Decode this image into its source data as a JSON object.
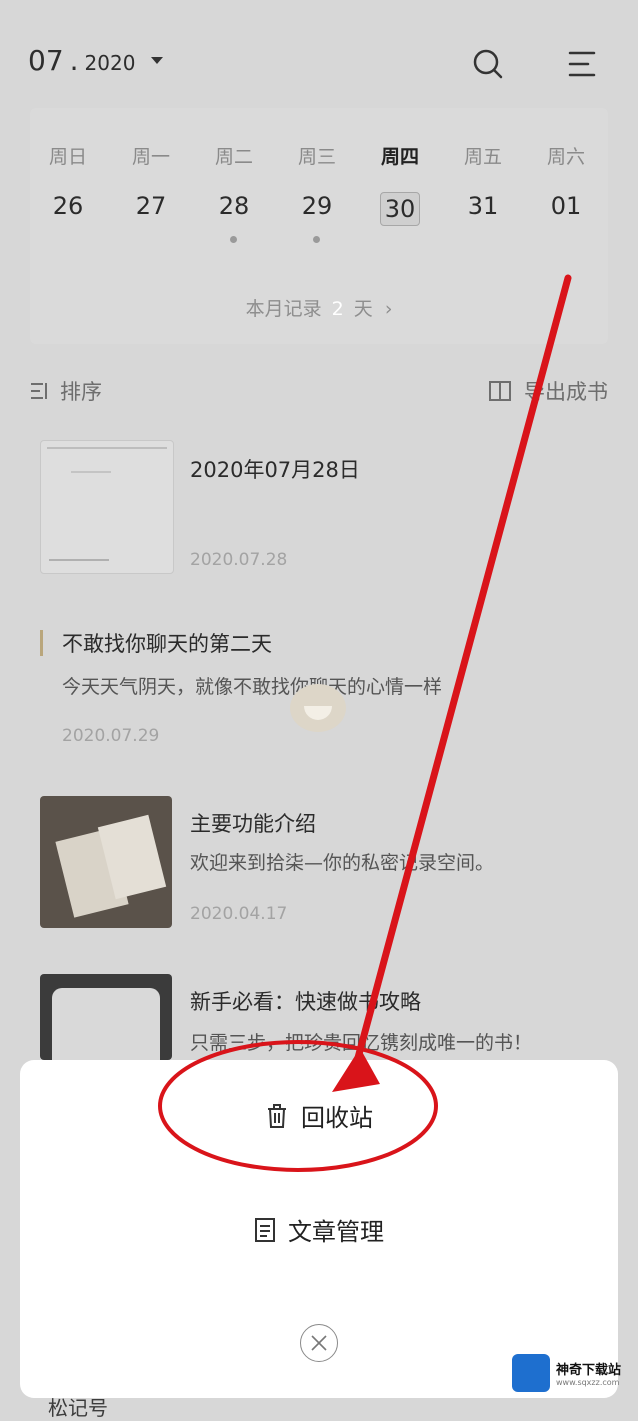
{
  "header": {
    "month": "07",
    "year": "2020",
    "separator": "."
  },
  "calendar": {
    "weekdays": [
      "周日",
      "周一",
      "周二",
      "周三",
      "周四",
      "周五",
      "周六"
    ],
    "days": [
      "26",
      "27",
      "28",
      "29",
      "30",
      "31",
      "01"
    ],
    "selected_index": 4,
    "month_records_prefix": "本月记录",
    "month_records_count": "2",
    "month_records_suffix": "天"
  },
  "toolbar": {
    "sort_label": "排序",
    "export_label": "导出成书"
  },
  "entries": [
    {
      "title": "2020年07月28日",
      "desc": "",
      "date": "2020.07.28"
    },
    {
      "title": "不敢找你聊天的第二天",
      "desc": "今天天气阴天，就像不敢找你聊天的心情一样",
      "date": "2020.07.29"
    },
    {
      "title": "主要功能介绍",
      "desc": "欢迎来到拾柒—你的私密记录空间。",
      "date": "2020.04.17"
    },
    {
      "title": "新手必看：快速做书攻略",
      "desc": "只需三步，把珍贵回忆镌刻成唯一的书！",
      "date": ""
    }
  ],
  "sheet": {
    "recycle_label": "回收站",
    "manage_label": "文章管理"
  },
  "bottom_nav": {
    "partial_label": "松记号"
  },
  "watermark": {
    "title": "神奇下载站",
    "url": "www.sqxzz.com"
  },
  "colors": {
    "annotation_red": "#d9141a",
    "dim_background": "#d7d7d7",
    "sheet_bg": "#ffffff",
    "watermark_blue": "#1e6fcf"
  }
}
